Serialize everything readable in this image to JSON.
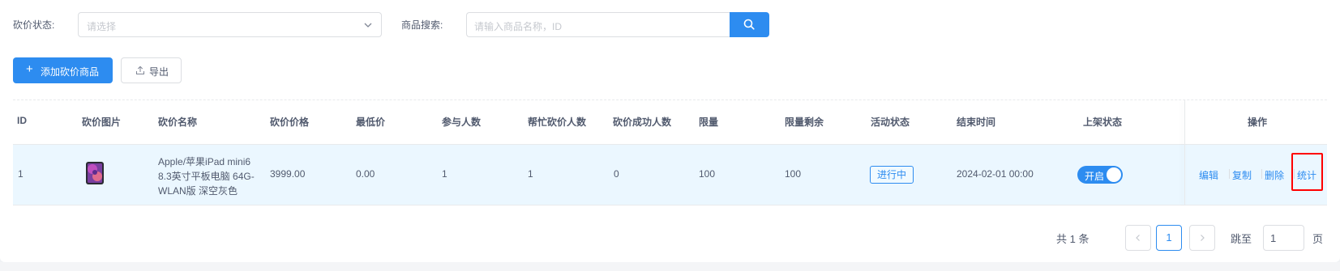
{
  "filters": {
    "status_label": "砍价状态:",
    "status_placeholder": "请选择",
    "search_label": "商品搜索:",
    "search_placeholder": "请输入商品名称，ID"
  },
  "toolbar": {
    "add_label": "添加砍价商品",
    "export_label": "导出"
  },
  "table": {
    "headers": [
      "ID",
      "砍价图片",
      "砍价名称",
      "砍价价格",
      "最低价",
      "参与人数",
      "帮忙砍价人数",
      "砍价成功人数",
      "限量",
      "限量剩余",
      "活动状态",
      "结束时间",
      "上架状态",
      "操作"
    ],
    "rows": [
      {
        "id": "1",
        "name": "Apple/苹果iPad mini6 8.3英寸平板电脑 64G-WLAN版 深空灰色",
        "price": "3999.00",
        "min_price": "0.00",
        "participants": "1",
        "helpers": "1",
        "success": "0",
        "limit": "100",
        "limit_remaining": "100",
        "activity_status": "进行中",
        "end_time": "2024-02-01 00:00",
        "shelf_status": "开启",
        "shelf_on": true,
        "actions": [
          "编辑",
          "复制",
          "删除",
          "统计"
        ]
      }
    ]
  },
  "pagination": {
    "total_label": "共 1 条",
    "current_page": "1",
    "jump_label": "跳至",
    "jump_value": "1",
    "page_suffix": "页"
  },
  "colors": {
    "primary": "#2d8cf0",
    "row_highlight": "#ebf7ff",
    "annotation_box": "#ff0000"
  }
}
